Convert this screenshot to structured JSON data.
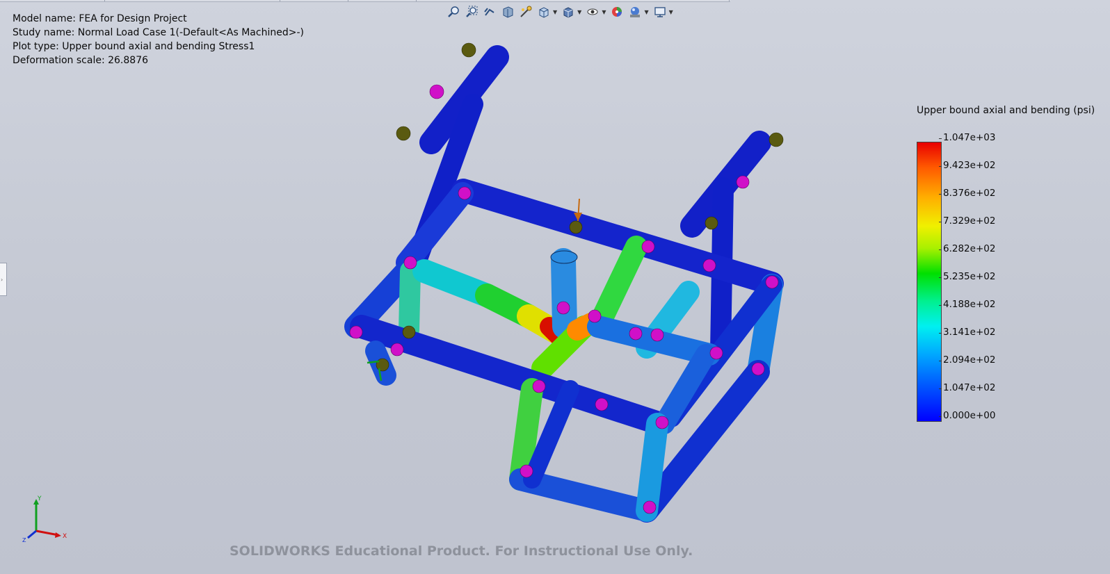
{
  "window": {
    "info": {
      "model_name": "Model name: FEA for Design Project",
      "study_name": "Study name: Normal Load Case 1(-Default<As Machined>-)",
      "plot_type": "Plot type: Upper bound axial and bending Stress1",
      "deformation_scale": "Deformation scale: 26.8876"
    },
    "toolbar": {
      "icons": [
        "zoom-to-fit-icon",
        "zoom-to-area-icon",
        "previous-view-icon",
        "section-view-icon",
        "dynamic-annotation-icon",
        "view-orientation-icon",
        "display-style-icon",
        "hide-show-items-icon",
        "edit-appearance-icon",
        "apply-scene-icon",
        "view-settings-icon"
      ]
    },
    "legend": {
      "title": "Upper bound axial and bending (psi)",
      "values": [
        "1.047e+03",
        "9.423e+02",
        "8.376e+02",
        "7.329e+02",
        "6.282e+02",
        "5.235e+02",
        "4.188e+02",
        "3.141e+02",
        "2.094e+02",
        "1.047e+02",
        "0.000e+00"
      ],
      "colors": {
        "max": "#e80000",
        "min": "#0000ff"
      }
    },
    "triad": {
      "y": "Y",
      "x": "X",
      "z": "Z"
    },
    "watermark": "SOLIDWORKS Educational Product. For Instructional Use Only."
  }
}
